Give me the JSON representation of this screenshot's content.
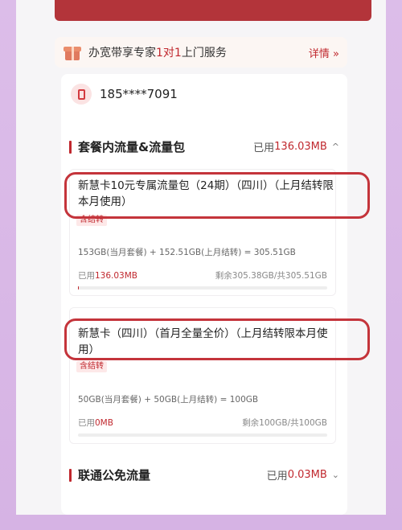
{
  "banner": {
    "text_before": "办宽带享专家",
    "text_highlight": "1对1",
    "text_after": "上门服务",
    "more_label": "详情 »"
  },
  "account": {
    "phone": "185****7091"
  },
  "section1": {
    "title": "套餐内流量&流量包",
    "used_label": "已用",
    "used_value": "136.03MB",
    "chevron": "^"
  },
  "packages": [
    {
      "title": "新慧卡10元专属流量包（24期）（四川）（上月结转限本月使用）",
      "tag": "含结转",
      "formula": "153GB(当月套餐) + 152.51GB(上月结转) = 305.51GB",
      "used_label": "已用",
      "used_value": "136.03MB",
      "remain": "剩余305.38GB/共305.51GB",
      "progress": 0.0004
    },
    {
      "title": "新慧卡（四川）（首月全量全价）（上月结转限本月使用）",
      "tag": "含结转",
      "formula": "50GB(当月套餐) + 50GB(上月结转) = 100GB",
      "used_label": "已用",
      "used_value": "0MB",
      "remain": "剩余100GB/共100GB",
      "progress": 0
    }
  ],
  "section2": {
    "title": "联通公免流量",
    "used_label": "已用",
    "used_value": "0.03MB",
    "chevron": "⌄"
  },
  "colors": {
    "accent": "#c0282e",
    "annotation_circle": "#c4343b",
    "frame": "#d9b8e6"
  }
}
